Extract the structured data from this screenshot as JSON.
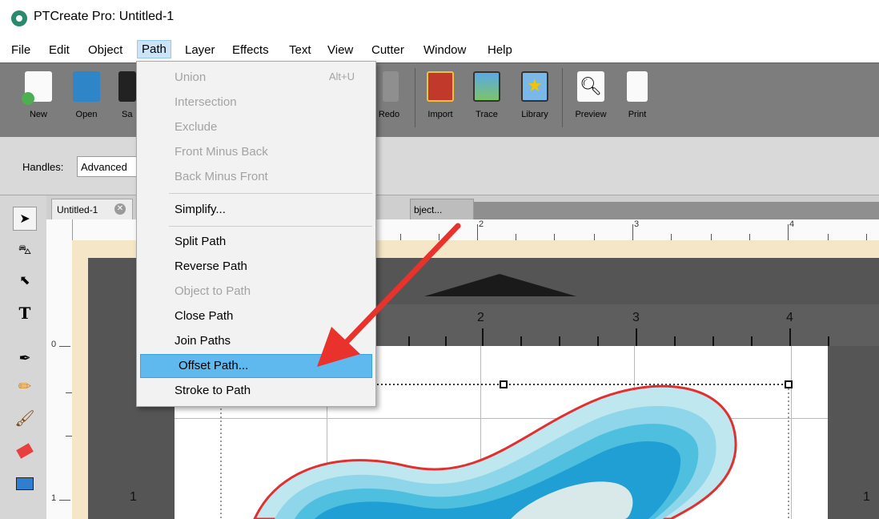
{
  "window": {
    "title": "PTCreate Pro: Untitled-1"
  },
  "menubar": [
    "File",
    "Edit",
    "Object",
    "Path",
    "Layer",
    "Effects",
    "Text",
    "View",
    "Cutter",
    "Window",
    "Help"
  ],
  "toolbar": {
    "new": "New",
    "open": "Open",
    "save": "Sa",
    "redo": "Redo",
    "import": "Import",
    "trace": "Trace",
    "library": "Library",
    "preview": "Preview",
    "print": "Print"
  },
  "options": {
    "handles_label": "Handles:",
    "handles_value": "Advanced"
  },
  "tabs": {
    "document": "Untitled-1",
    "object": "bject..."
  },
  "path_menu": {
    "union": "Union",
    "union_shortcut": "Alt+U",
    "intersection": "Intersection",
    "exclude": "Exclude",
    "front_minus_back": "Front Minus Back",
    "back_minus_front": "Back Minus Front",
    "simplify": "Simplify...",
    "split_path": "Split Path",
    "reverse_path": "Reverse Path",
    "object_to_path": "Object to Path",
    "close_path": "Close Path",
    "join_paths": "Join Paths",
    "offset_path": "Offset Path...",
    "stroke_to_path": "Stroke to Path"
  },
  "ruler": {
    "top": [
      "2",
      "3",
      "4"
    ],
    "inner": [
      "2",
      "3",
      "4"
    ],
    "left": [
      "0",
      "1"
    ],
    "right": [
      "1"
    ]
  },
  "colors": {
    "highlight": "#5fb9ef",
    "arrow": "#e8322b",
    "shape_outline": "#e03030",
    "shape_fill": "#7fd0e6"
  }
}
